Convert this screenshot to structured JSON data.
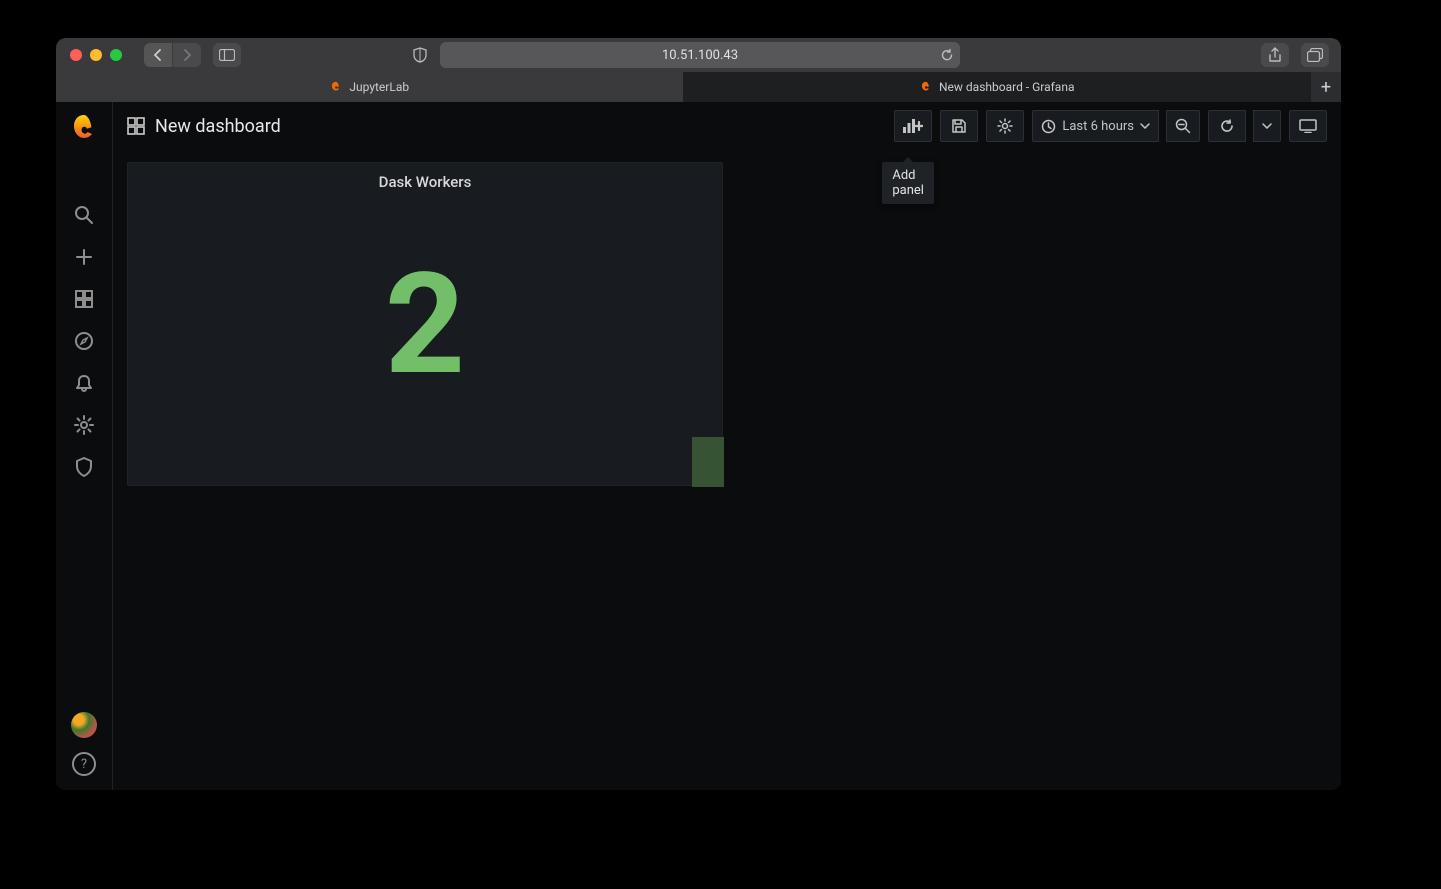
{
  "safari": {
    "url": "10.51.100.43",
    "tabs": [
      {
        "label": "JupyterLab",
        "active": false,
        "icon": "grafana-mini-icon"
      },
      {
        "label": "New dashboard - Grafana",
        "active": true,
        "icon": "grafana-mini-icon"
      }
    ]
  },
  "grafana": {
    "title": "New dashboard",
    "toolbar": {
      "add_panel_tooltip": "Add panel",
      "time_range_label": "Last 6 hours"
    },
    "leftnav": [
      {
        "name": "search-icon"
      },
      {
        "name": "plus-icon"
      },
      {
        "name": "dashboards-icon"
      },
      {
        "name": "explore-icon"
      },
      {
        "name": "alerting-icon"
      },
      {
        "name": "configuration-icon"
      },
      {
        "name": "admin-icon"
      }
    ],
    "panel": {
      "title": "Dask Workers",
      "value": "2",
      "value_color": "#73bf69"
    }
  }
}
